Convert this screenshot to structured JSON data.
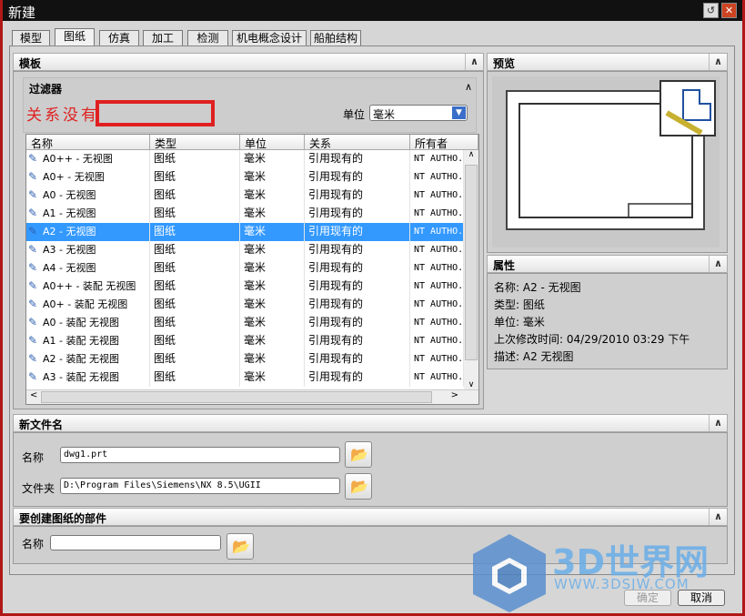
{
  "window": {
    "title": "新建"
  },
  "tabs": [
    "模型",
    "图纸",
    "仿真",
    "加工",
    "检测",
    "机电概念设计",
    "船舶结构"
  ],
  "active_tab": "图纸",
  "template": {
    "header": "模板",
    "filter": {
      "header": "过滤器",
      "annotation": "关系没有",
      "unit_label": "单位",
      "unit_value": "毫米"
    },
    "columns": [
      "名称",
      "类型",
      "单位",
      "关系",
      "所有者"
    ],
    "rows": [
      [
        "A0++ - 无视图",
        "图纸",
        "毫米",
        "引用现有的",
        "NT AUTHO."
      ],
      [
        "A0+ - 无视图",
        "图纸",
        "毫米",
        "引用现有的",
        "NT AUTHO."
      ],
      [
        "A0 - 无视图",
        "图纸",
        "毫米",
        "引用现有的",
        "NT AUTHO."
      ],
      [
        "A1 - 无视图",
        "图纸",
        "毫米",
        "引用现有的",
        "NT AUTHO."
      ],
      [
        "A2 - 无视图",
        "图纸",
        "毫米",
        "引用现有的",
        "NT AUTHO."
      ],
      [
        "A3 - 无视图",
        "图纸",
        "毫米",
        "引用现有的",
        "NT AUTHO."
      ],
      [
        "A4 - 无视图",
        "图纸",
        "毫米",
        "引用现有的",
        "NT AUTHO."
      ],
      [
        "A0++ - 装配 无视图",
        "图纸",
        "毫米",
        "引用现有的",
        "NT AUTHO."
      ],
      [
        "A0+ - 装配 无视图",
        "图纸",
        "毫米",
        "引用现有的",
        "NT AUTHO."
      ],
      [
        "A0 - 装配 无视图",
        "图纸",
        "毫米",
        "引用现有的",
        "NT AUTHO."
      ],
      [
        "A1 - 装配 无视图",
        "图纸",
        "毫米",
        "引用现有的",
        "NT AUTHO."
      ],
      [
        "A2 - 装配 无视图",
        "图纸",
        "毫米",
        "引用现有的",
        "NT AUTHO."
      ],
      [
        "A3 - 装配 无视图",
        "图纸",
        "毫米",
        "引用现有的",
        "NT AUTHO."
      ]
    ],
    "selected_index": 4
  },
  "preview": {
    "header": "预览"
  },
  "properties": {
    "header": "属性",
    "items": [
      {
        "label": "名称:",
        "value": "A2 - 无视图"
      },
      {
        "label": "类型:",
        "value": "图纸"
      },
      {
        "label": "单位:",
        "value": "毫米"
      },
      {
        "label": "上次修改时间:",
        "value": "04/29/2010 03:29 下午"
      },
      {
        "label": "描述:",
        "value": "A2 无视图"
      }
    ]
  },
  "new_file": {
    "header": "新文件名",
    "name_label": "名称",
    "name_value": "dwg1.prt",
    "folder_label": "文件夹",
    "folder_value": "D:\\Program Files\\Siemens\\NX 8.5\\UGII"
  },
  "part": {
    "header": "要创建图纸的部件",
    "name_label": "名称",
    "name_value": ""
  },
  "buttons": {
    "ok": "确定",
    "cancel": "取消"
  },
  "watermark": {
    "text": "3D世界网",
    "url": "WWW.3DSJW.COM"
  },
  "colors": {
    "selection": "#3399ff",
    "annotation": "#e02020"
  }
}
